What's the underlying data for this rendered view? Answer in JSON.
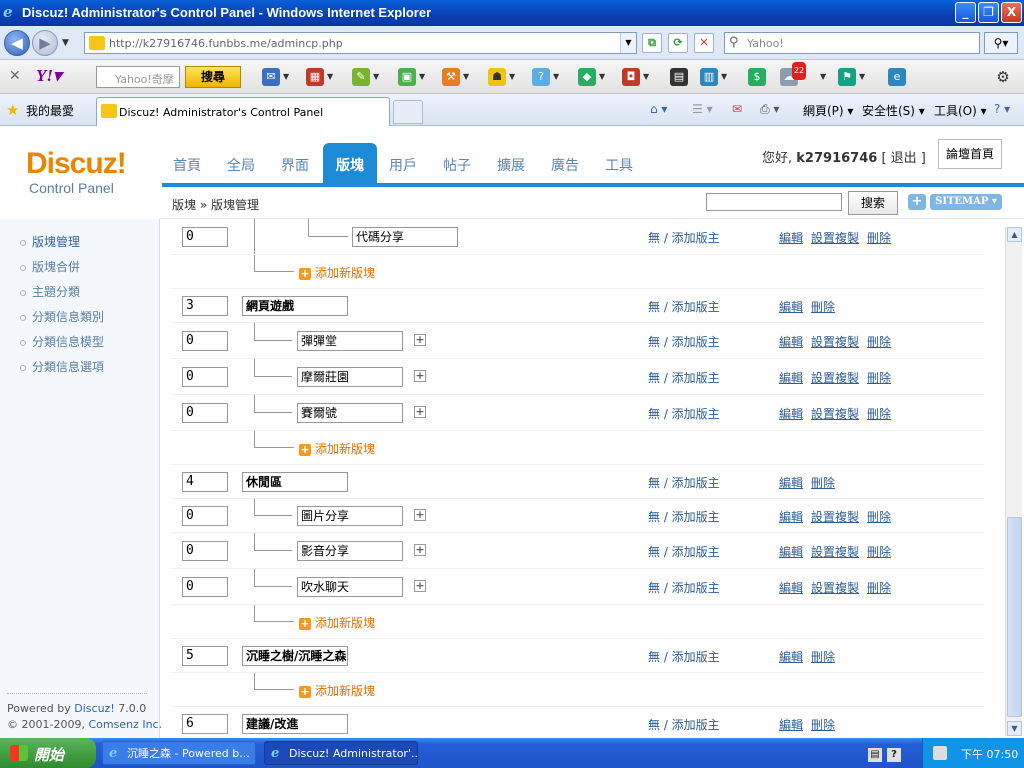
{
  "window": {
    "title": "Discuz! Administrator's Control Panel - Windows Internet Explorer",
    "controls": [
      "_",
      "❐",
      "X"
    ]
  },
  "address_bar": {
    "url": "http://k27916746.funbbs.me/admincp.php",
    "search_placeholder": "Yahoo!"
  },
  "yahoo_toolbar": {
    "search_placeholder": "Yahoo!奇摩",
    "search_button": "搜尋",
    "badge_count": "22"
  },
  "favorites_bar": {
    "favorites_label": "我的最愛",
    "tab_label": "Discuz! Administrator's Control Panel",
    "page_menu": "網頁(P)",
    "safety_menu": "安全性(S)",
    "tools_menu": "工具(O)"
  },
  "header": {
    "brand": "Discuz!",
    "brand_sub": "Control Panel",
    "nav": [
      "首頁",
      "全局",
      "界面",
      "版塊",
      "用戶",
      "帖子",
      "擴展",
      "廣告",
      "工具"
    ],
    "active_nav": "版塊",
    "greeting_prefix": "您好,",
    "username": "k27916746",
    "logout": "[ 退出 ]",
    "home_button": "論壇首頁"
  },
  "subbar": {
    "breadcrumb": "版塊 » 版塊管理",
    "search_button": "搜索",
    "sitemap_label": "SITEMAP ▾",
    "plus_label": "+"
  },
  "sidebar": {
    "items": [
      "版塊管理",
      "版塊合併",
      "主題分類",
      "分類信息類別",
      "分類信息模型",
      "分類信息選項"
    ],
    "active_index": 0,
    "powered_prefix": "Powered by",
    "powered_brand": "Discuz!",
    "powered_version": "7.0.0",
    "copyright_prefix": "© 2001-2009,",
    "copyright_company": "Comsenz Inc."
  },
  "forum_list": {
    "mod_text": "無 / 添加版主",
    "add_forum_text": "添加新版塊",
    "actions": {
      "edit": "編輯",
      "copy": "設置複製",
      "delete": "刪除"
    },
    "rows": [
      {
        "type": "sub",
        "order": "0",
        "name": "代碼分享"
      },
      {
        "type": "add"
      },
      {
        "type": "group",
        "order": "3",
        "name": "網頁遊戲"
      },
      {
        "type": "sub",
        "order": "0",
        "name": "彈彈堂"
      },
      {
        "type": "sub",
        "order": "0",
        "name": "摩爾莊園"
      },
      {
        "type": "sub",
        "order": "0",
        "name": "賽爾號"
      },
      {
        "type": "add"
      },
      {
        "type": "group",
        "order": "4",
        "name": "休閒區"
      },
      {
        "type": "sub",
        "order": "0",
        "name": "圖片分享"
      },
      {
        "type": "sub",
        "order": "0",
        "name": "影音分享"
      },
      {
        "type": "sub",
        "order": "0",
        "name": "吹水聊天"
      },
      {
        "type": "add"
      },
      {
        "type": "group",
        "order": "5",
        "name": "沉睡之樹/沉睡之森"
      },
      {
        "type": "add"
      },
      {
        "type": "group",
        "order": "6",
        "name": "建議/改進"
      }
    ]
  },
  "taskbar": {
    "start_label": "開始",
    "tasks": [
      "沉睡之森 - Powered b...",
      "Discuz! Administrator'..."
    ],
    "active_task": 1,
    "clock": "下午 07:50"
  },
  "colors": {
    "accent_blue": "#1d8ad6",
    "brand_orange": "#e98600",
    "link_blue": "#2d5d95",
    "add_orange": "#e07000"
  }
}
